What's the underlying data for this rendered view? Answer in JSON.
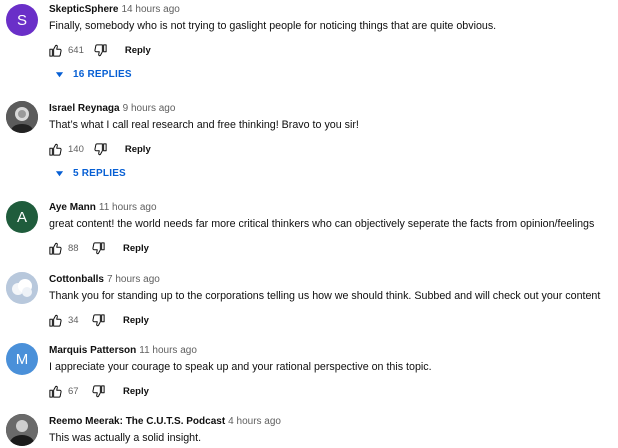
{
  "comments": [
    {
      "author": "SkepticSphere",
      "time": "14 hours ago",
      "text": "Finally, somebody who is not trying to gaslight people for noticing things that are quite obvious.",
      "likes": "641",
      "reply_label": "Reply",
      "avatar_letter": "S",
      "avatar_color": "#6a2fc8",
      "replies_label": "16 REPLIES"
    },
    {
      "author": "Israel Reynaga",
      "time": "9 hours ago",
      "text": "That’s what I call real research and free thinking! Bravo to you sir!",
      "likes": "140",
      "reply_label": "Reply",
      "avatar_letter": "",
      "avatar_color": "#3a3a3a",
      "replies_label": "5 REPLIES"
    },
    {
      "author": "Aye Mann",
      "time": "11 hours ago",
      "text": "great content! the world needs far more critical thinkers who can objectively seperate the facts from opinion/feelings",
      "likes": "88",
      "reply_label": "Reply",
      "avatar_letter": "A",
      "avatar_color": "#1f5c3c"
    },
    {
      "author": "Cottonballs",
      "time": "7 hours ago",
      "text": "Thank you for standing up to the corporations telling us how we should think. Subbed and will check out your content",
      "likes": "34",
      "reply_label": "Reply",
      "avatar_letter": "",
      "avatar_color": "#c9d6e6"
    },
    {
      "author": "Marquis Patterson",
      "time": "11 hours ago",
      "text": "I appreciate your courage to speak up and your rational perspective on this topic.",
      "likes": "67",
      "reply_label": "Reply",
      "avatar_letter": "M",
      "avatar_color": "#4a90d9"
    },
    {
      "author": "Reemo Meerak: The C.U.T.S. Podcast",
      "time": "4 hours ago",
      "text": "This was actually a solid insight.",
      "avatar_letter": "",
      "avatar_color": "#2b2b2b"
    }
  ],
  "colors": {
    "link_blue": "#065fd4",
    "secondary_text": "#606060"
  }
}
